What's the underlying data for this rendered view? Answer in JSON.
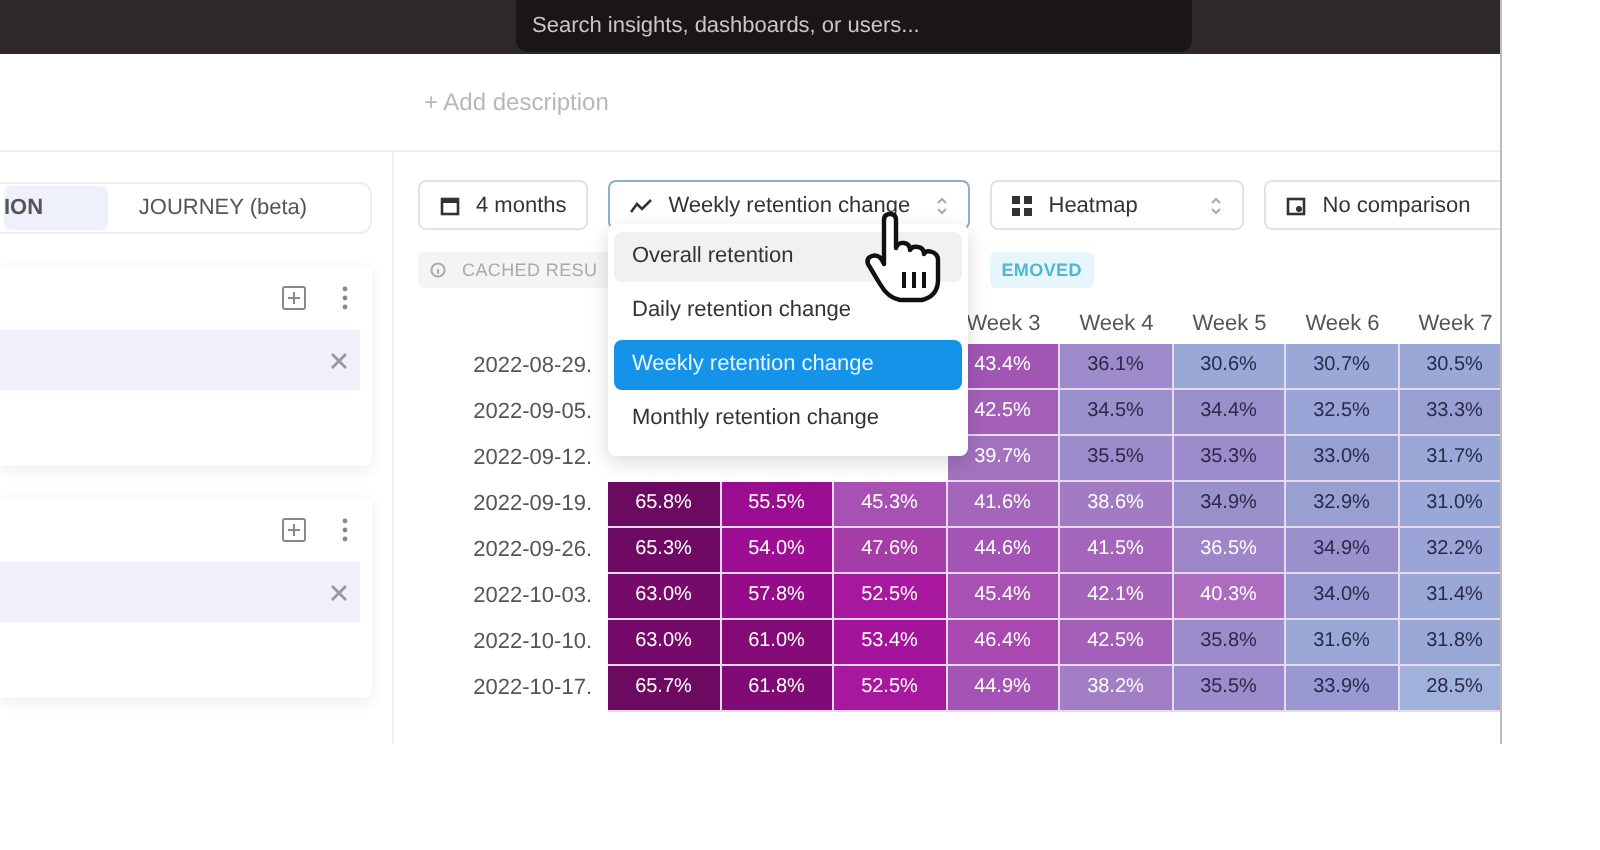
{
  "search": {
    "placeholder": "Search insights, dashboards, or users..."
  },
  "description_link": "+ Add description",
  "tabs": [
    {
      "label": "ION",
      "selected": true
    },
    {
      "label": "JOURNEY (beta)",
      "selected": false
    }
  ],
  "cards": [
    {
      "kind": "series"
    },
    {
      "kind": "series"
    }
  ],
  "toolbar": [
    {
      "kind": "date",
      "label": "4 months",
      "focused": false
    },
    {
      "kind": "trend",
      "label": "Weekly retention change",
      "focused": true
    },
    {
      "kind": "grid",
      "label": "Heatmap",
      "focused": false
    },
    {
      "kind": "calendar",
      "label": "No comparison",
      "focused": false
    }
  ],
  "chips": [
    {
      "label": "CACHED RESU",
      "kind": "info"
    },
    {
      "label": "EMOVED",
      "kind": "note"
    }
  ],
  "dropdown": {
    "options": [
      {
        "label": "Overall retention",
        "selected": false,
        "hovered": true
      },
      {
        "label": "Daily retention change",
        "selected": false,
        "hovered": false
      },
      {
        "label": "Weekly retention change",
        "selected": true,
        "hovered": false
      },
      {
        "label": "Monthly retention change",
        "selected": false,
        "hovered": false
      }
    ]
  },
  "heatmap": {
    "headers": [
      "Week 3",
      "Week 4",
      "Week 5",
      "Week 6",
      "Week 7"
    ],
    "rows": [
      {
        "date": "2022-08-29.",
        "cells": [
          {
            "text": "43.4%",
            "color": "#a256b4"
          },
          {
            "text": "36.1%",
            "color": "#9c8acb"
          },
          {
            "text": "30.6%",
            "color": "#9aa8d8"
          },
          {
            "text": "30.7%",
            "color": "#9aa8d8"
          },
          {
            "text": "30.5%",
            "color": "#9aa8d8"
          }
        ]
      },
      {
        "date": "2022-09-05.",
        "cells": [
          {
            "text": "42.5%",
            "color": "#a460b8"
          },
          {
            "text": "34.5%",
            "color": "#9a90cc"
          },
          {
            "text": "34.4%",
            "color": "#9a90cc"
          },
          {
            "text": "32.5%",
            "color": "#9aa4d6"
          },
          {
            "text": "33.3%",
            "color": "#98a0d2"
          }
        ]
      },
      {
        "date": "2022-09-12.",
        "cells": [
          {
            "text": "39.7%",
            "color": "#a272be"
          },
          {
            "text": "35.5%",
            "color": "#9c8ccc"
          },
          {
            "text": "35.3%",
            "color": "#9c8ccc"
          },
          {
            "text": "33.0%",
            "color": "#98a0d2"
          },
          {
            "text": "31.7%",
            "color": "#9aa8d8"
          }
        ]
      },
      {
        "date": "2022-09-19.",
        "cells": [
          {
            "text": "65.8%",
            "color": "#6c0a62"
          },
          {
            "text": "55.5%",
            "color": "#9a0c90"
          },
          {
            "text": "45.3%",
            "color": "#a850b4"
          },
          {
            "text": "41.6%",
            "color": "#a466ba"
          },
          {
            "text": "38.6%",
            "color": "#a27cc2"
          },
          {
            "text": "34.9%",
            "color": "#9a90cc"
          },
          {
            "text": "32.9%",
            "color": "#98a0d2"
          },
          {
            "text": "31.0%",
            "color": "#9aa8d8"
          }
        ]
      },
      {
        "date": "2022-09-26.",
        "cells": [
          {
            "text": "65.3%",
            "color": "#6e0a64"
          },
          {
            "text": "54.0%",
            "color": "#9e0e94"
          },
          {
            "text": "47.6%",
            "color": "#a63ca8"
          },
          {
            "text": "44.6%",
            "color": "#a454b4"
          },
          {
            "text": "41.5%",
            "color": "#a466ba"
          },
          {
            "text": "36.5%",
            "color": "#9e86c8"
          },
          {
            "text": "34.9%",
            "color": "#9a90cc"
          },
          {
            "text": "32.2%",
            "color": "#9aa4d6"
          }
        ]
      },
      {
        "date": "2022-10-03.",
        "cells": [
          {
            "text": "63.0%",
            "color": "#760a6a"
          },
          {
            "text": "57.8%",
            "color": "#940c8a"
          },
          {
            "text": "52.5%",
            "color": "#a8189e"
          },
          {
            "text": "45.4%",
            "color": "#a850b4"
          },
          {
            "text": "42.1%",
            "color": "#a462b8"
          },
          {
            "text": "40.3%",
            "color": "#ae6cc0"
          },
          {
            "text": "34.0%",
            "color": "#9a98d0"
          },
          {
            "text": "31.4%",
            "color": "#9aa8d8"
          }
        ]
      },
      {
        "date": "2022-10-10.",
        "cells": [
          {
            "text": "63.0%",
            "color": "#760a6a"
          },
          {
            "text": "61.0%",
            "color": "#840a78"
          },
          {
            "text": "53.4%",
            "color": "#a4149a"
          },
          {
            "text": "46.4%",
            "color": "#a848b0"
          },
          {
            "text": "42.5%",
            "color": "#a460b8"
          },
          {
            "text": "35.8%",
            "color": "#9c8ccc"
          },
          {
            "text": "31.6%",
            "color": "#9aa8d8"
          },
          {
            "text": "31.8%",
            "color": "#9aa8d8"
          }
        ]
      },
      {
        "date": "2022-10-17.",
        "cells": [
          {
            "text": "65.7%",
            "color": "#6c0a62"
          },
          {
            "text": "61.8%",
            "color": "#800a76"
          },
          {
            "text": "52.5%",
            "color": "#a8189e"
          },
          {
            "text": "44.9%",
            "color": "#a454b4"
          },
          {
            "text": "38.2%",
            "color": "#a27ec4"
          },
          {
            "text": "35.5%",
            "color": "#9c8ccc"
          },
          {
            "text": "33.9%",
            "color": "#9a98d0"
          },
          {
            "text": "28.5%",
            "color": "#a0b2dc"
          }
        ]
      }
    ]
  }
}
